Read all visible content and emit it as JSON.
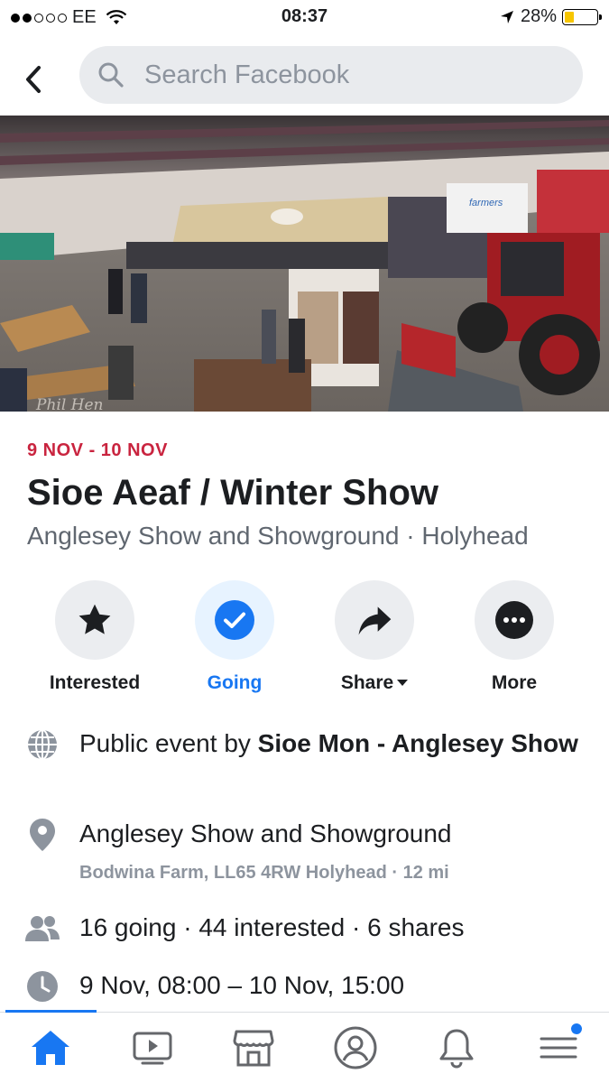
{
  "status_bar": {
    "carrier": "EE",
    "time": "08:37",
    "battery": "28%",
    "battery_level": 0.28
  },
  "search": {
    "placeholder": "Search Facebook"
  },
  "event": {
    "date_range": "9 NOV - 10 NOV",
    "title": "Sioe Aeaf / Winter Show",
    "subtitle": "Anglesey Show and Showground · Holyhead"
  },
  "actions": [
    {
      "label": "Interested",
      "icon": "star-icon"
    },
    {
      "label": "Going",
      "icon": "check-icon",
      "active": true
    },
    {
      "label": "Share",
      "icon": "share-icon"
    },
    {
      "label": "More",
      "icon": "more-icon"
    }
  ],
  "details": {
    "host_prefix": "Public event by ",
    "host_name": "Sioe Mon - Anglesey Show",
    "location_name": "Anglesey Show and Showground",
    "location_address": "Bodwina Farm, LL65 4RW Holyhead · 12 mi",
    "attendance": "16 going · 44 interested · 6 shares",
    "time": "9 Nov, 08:00 – 10 Nov, 15:00"
  },
  "photo_watermark": "Phil Hen",
  "tabs": [
    "home-icon",
    "video-icon",
    "marketplace-icon",
    "profile-icon",
    "notifications-icon",
    "menu-icon"
  ],
  "colors": {
    "accent": "#1877f2",
    "date_red": "#c9243f",
    "muted": "#606770",
    "button_bg": "#ebedf0"
  }
}
